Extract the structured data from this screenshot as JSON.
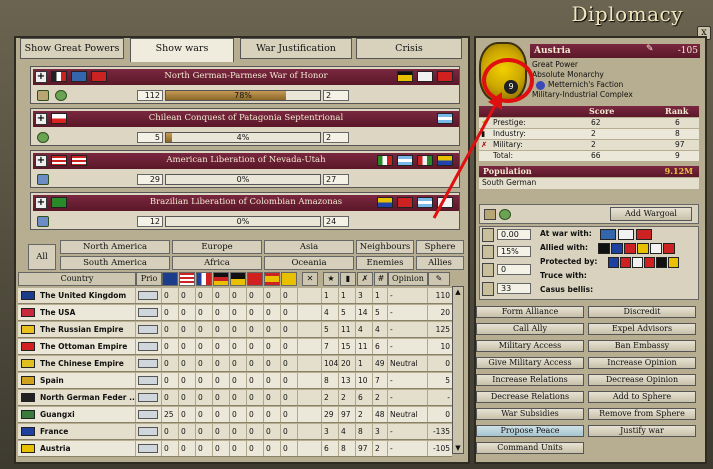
{
  "window": {
    "title": "Diplomacy",
    "close_label": "x"
  },
  "tabs": [
    {
      "label": "Show Great Powers",
      "active": false
    },
    {
      "label": "Show wars",
      "active": true
    },
    {
      "label": "War Justification",
      "active": false
    },
    {
      "label": "Crisis",
      "active": false
    }
  ],
  "wars": [
    {
      "name": "North German-Parmese War of Honor",
      "attacker_score": "112",
      "progress_label": "78%",
      "progress": 0.78,
      "defender_score": "2"
    },
    {
      "name": "Chilean Conquest of Patagonia Septentrional",
      "attacker_score": "5",
      "progress_label": "4%",
      "progress": 0.04,
      "defender_score": "2"
    },
    {
      "name": "American Liberation of Nevada-Utah",
      "attacker_score": "29",
      "progress_label": "0%",
      "progress": 0.0,
      "defender_score": "27"
    },
    {
      "name": "Brazilian Liberation of Colombian Amazonas",
      "attacker_score": "12",
      "progress_label": "0%",
      "progress": 0.0,
      "defender_score": "24"
    }
  ],
  "filters": {
    "all": "All",
    "regions": [
      "North America",
      "Europe",
      "Asia",
      "Neighbours",
      "Sphere",
      "South America",
      "Africa",
      "Oceania",
      "Enemies",
      "Allies"
    ]
  },
  "table": {
    "headers": {
      "country": "Country",
      "prio": "Prio",
      "opinion": "Opinion",
      "hash": "#"
    },
    "rows": [
      {
        "name": "The United Kingdom",
        "vals": [
          "0",
          "0",
          "0",
          "0",
          "0",
          "0",
          "0",
          "0"
        ],
        "s1": "1",
        "s2": "1",
        "s3": "3",
        "s4": "1",
        "opinion": "-",
        "rel": "110",
        "flag": "#1c3c8c"
      },
      {
        "name": "The USA",
        "vals": [
          "0",
          "0",
          "0",
          "0",
          "0",
          "0",
          "0",
          "0"
        ],
        "s1": "4",
        "s2": "5",
        "s3": "14",
        "s4": "5",
        "opinion": "-",
        "rel": "20",
        "flag": "#c8283c"
      },
      {
        "name": "The Russian Empire",
        "vals": [
          "0",
          "0",
          "0",
          "0",
          "0",
          "0",
          "0",
          "0"
        ],
        "s1": "5",
        "s2": "11",
        "s3": "4",
        "s4": "4",
        "opinion": "-",
        "rel": "125",
        "flag": "#e8c020"
      },
      {
        "name": "The Ottoman Empire",
        "vals": [
          "0",
          "0",
          "0",
          "0",
          "0",
          "0",
          "0",
          "0"
        ],
        "s1": "7",
        "s2": "15",
        "s3": "11",
        "s4": "6",
        "opinion": "-",
        "rel": "10",
        "flag": "#d02020"
      },
      {
        "name": "The Chinese Empire",
        "vals": [
          "0",
          "0",
          "0",
          "0",
          "0",
          "0",
          "0",
          "0"
        ],
        "s1": "104",
        "s2": "20",
        "s3": "1",
        "s4": "49",
        "opinion": "Neutral",
        "rel": "0",
        "flag": "#e0c020"
      },
      {
        "name": "Spain",
        "vals": [
          "0",
          "0",
          "0",
          "0",
          "0",
          "0",
          "0",
          "0"
        ],
        "s1": "8",
        "s2": "13",
        "s3": "10",
        "s4": "7",
        "opinion": "-",
        "rel": "5",
        "flag": "#d0a020"
      },
      {
        "name": "North German Feder ...",
        "vals": [
          "0",
          "0",
          "0",
          "0",
          "0",
          "0",
          "0",
          "0"
        ],
        "s1": "2",
        "s2": "2",
        "s3": "6",
        "s4": "2",
        "opinion": "-",
        "rel": "-",
        "flag": "#222222"
      },
      {
        "name": "Guangxi",
        "vals": [
          "25",
          "0",
          "0",
          "0",
          "0",
          "0",
          "0",
          "0"
        ],
        "s1": "29",
        "s2": "97",
        "s3": "2",
        "s4": "48",
        "opinion": "Neutral",
        "rel": "0",
        "flag": "#3a7a3a"
      },
      {
        "name": "France",
        "vals": [
          "0",
          "0",
          "0",
          "0",
          "0",
          "0",
          "0",
          "0"
        ],
        "s1": "3",
        "s2": "4",
        "s3": "8",
        "s4": "3",
        "opinion": "-",
        "rel": "-135",
        "flag": "#2040a0"
      },
      {
        "name": "Austria",
        "vals": [
          "0",
          "0",
          "0",
          "0",
          "0",
          "0",
          "0",
          "0"
        ],
        "s1": "6",
        "s2": "8",
        "s3": "97",
        "s4": "2",
        "opinion": "-",
        "rel": "-105",
        "flag": "#e8c000"
      }
    ]
  },
  "country": {
    "name": "Austria",
    "relation": "-105",
    "rank_badge": "9",
    "status": "Great Power",
    "government": "Absolute Monarchy",
    "party": "Metternich's Faction",
    "ideology": "Military-Industrial Complex",
    "score_header": "Score",
    "rank_header": "Rank",
    "stats": [
      {
        "label": "Prestige:",
        "score": "62",
        "rank": "6"
      },
      {
        "label": "Industry:",
        "score": "2",
        "rank": "8"
      },
      {
        "label": "Military:",
        "score": "2",
        "rank": "97"
      },
      {
        "label": "Total:",
        "score": "66",
        "rank": "9"
      }
    ],
    "population_label": "Population",
    "population_value": "9.12M",
    "culture": "South German",
    "add_wargoal": "Add Wargoal",
    "diplo_values": [
      "0.00",
      "15%",
      "0",
      "33"
    ],
    "war_with": "At war with:",
    "allied_with": "Allied with:",
    "protected_by": "Protected by:",
    "truce_with": "Truce with:",
    "casus_bellis": "Casus bellis:"
  },
  "actions": [
    [
      "Form Alliance",
      "Discredit"
    ],
    [
      "Call Ally",
      "Expel Advisors"
    ],
    [
      "Military Access",
      "Ban Embassy"
    ],
    [
      "Give Military Access",
      "Increase Opinion"
    ],
    [
      "Increase Relations",
      "Decrease Opinion"
    ],
    [
      "Decrease Relations",
      "Add to Sphere"
    ],
    [
      "War Subsidies",
      "Remove from Sphere"
    ],
    [
      "Propose Peace",
      "Justify war"
    ],
    [
      "Command Units",
      ""
    ]
  ],
  "colors": {
    "war_header": "#6a1f34",
    "annotation": "#e01010"
  }
}
